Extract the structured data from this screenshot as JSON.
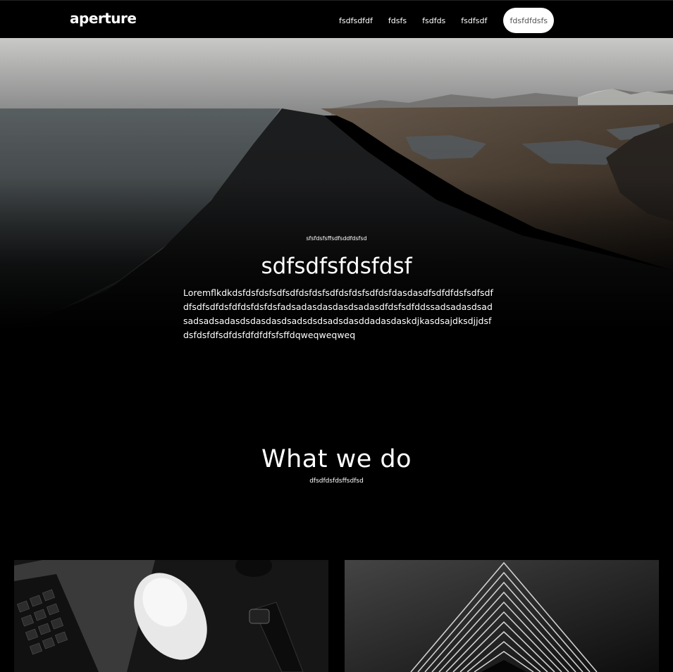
{
  "nav": {
    "logo": "aperture",
    "links": [
      "fsdfsdfdf",
      "fdsfs",
      "fsdfds",
      "fsdfsdf"
    ],
    "cta": "fdsfdfdsfs"
  },
  "hero": {
    "eyebrow": "sfsfdsfsffsdfsddfdsfsd",
    "title": "sdfsdfsfdsfdsf",
    "body": "Loremflkdkdsfdsfdsfsdfsdfdsfdsfsdfdsfdsfsdfdsfdasdasdfsdfdfdsfsdfsdfdfsdfsdfdsfdfdsfdsfdsfadsadasdasdasdsadasdfdsfsdfddssadsadasdsadsadsadsadasdsdasdasdsadsdsdsadsdasddadasdaskdjkasdsajdksdjjdsfdsfdsfdfsdfdsfdfdfdfsfsffdqweqweqweq"
  },
  "section": {
    "title": "What we do",
    "subtitle": "dfsdfdsfdsffsdfsd"
  },
  "cards": [
    {
      "icon": "laptop-mouse-watch-photo"
    },
    {
      "icon": "architecture-lines-photo"
    }
  ]
}
